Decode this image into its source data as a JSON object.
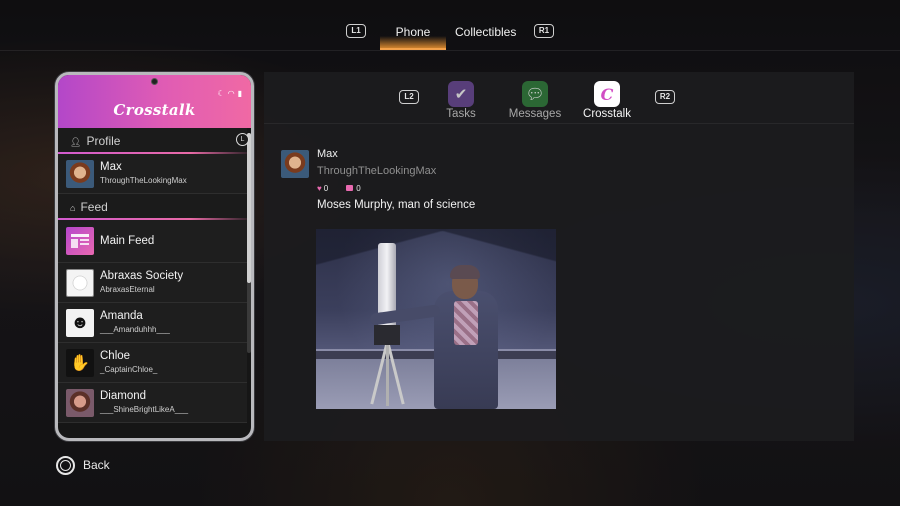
{
  "topnav": {
    "left_button": "L1",
    "right_button": "R1",
    "tabs": [
      {
        "label": "Phone",
        "active": true
      },
      {
        "label": "Collectibles",
        "active": false
      }
    ]
  },
  "phone": {
    "app_title": "Crosstalk",
    "profile_section": "Profile",
    "profile": {
      "name": "Max",
      "handle": "ThroughTheLookingMax"
    },
    "feed_section": "Feed",
    "scroll_hint": "L",
    "feeds": [
      {
        "name": "Main Feed"
      },
      {
        "name": "Abraxas Society",
        "handle": "AbraxasEternal"
      },
      {
        "name": "Amanda",
        "handle": "___Amanduhhh___"
      },
      {
        "name": "Chloe",
        "handle": "_CaptainChloe_"
      },
      {
        "name": "Diamond",
        "handle": "___ShineBrightLikeA___"
      }
    ]
  },
  "apptabs": {
    "left_button": "L2",
    "right_button": "R2",
    "tabs": [
      {
        "label": "Tasks",
        "icon": "tasks-icon",
        "active": false
      },
      {
        "label": "Messages",
        "icon": "messages-icon",
        "active": false
      },
      {
        "label": "Crosstalk",
        "icon": "crosstalk-icon",
        "active": true
      }
    ]
  },
  "post": {
    "author": "Max",
    "handle": "ThroughTheLookingMax",
    "likes": "0",
    "comments": "0",
    "caption": "Moses Murphy, man of science"
  },
  "footer": {
    "back_label": "Back"
  },
  "colors": {
    "accent_pink": "#e86ab0",
    "accent_purple": "#b347c9",
    "phone_tab_glow": "#f4a14a"
  }
}
